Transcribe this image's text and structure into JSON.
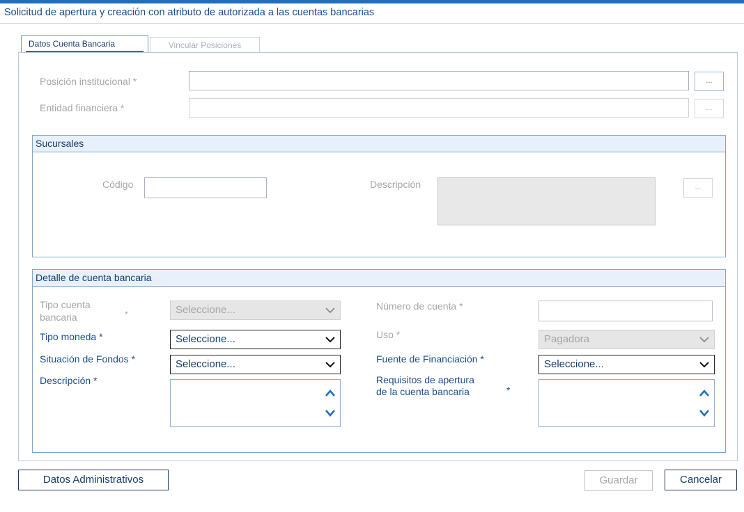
{
  "page": {
    "title": "Solicitud de apertura y creación con atributo de autorizada a las cuentas bancarias"
  },
  "tabs": [
    {
      "label": "Datos Cuenta Bancaria",
      "active": true
    },
    {
      "label": "Vincular Posiciones",
      "active": false
    }
  ],
  "form": {
    "posicion_label": "Posición institucional *",
    "posicion_value": "",
    "entidad_label": "Entidad financiera *",
    "entidad_value": "",
    "ellipsis": "..."
  },
  "sucursales": {
    "header": "Sucursales",
    "codigo_label": "Código",
    "codigo_value": "",
    "descripcion_label": "Descripción",
    "descripcion_value": ""
  },
  "detalle": {
    "header": "Detalle de cuenta bancaria",
    "tipo_cuenta_label_line1": "Tipo cuenta",
    "tipo_cuenta_label_line2": "bancaria",
    "tipo_cuenta_required": "*",
    "tipo_cuenta_value": "Seleccione...",
    "tipo_moneda_label": "Tipo moneda *",
    "tipo_moneda_value": "Seleccione...",
    "situacion_label": "Situación de Fondos *",
    "situacion_value": "Seleccione...",
    "descripcion_label": "Descripción  *",
    "numero_cuenta_label": "Número de cuenta  *",
    "numero_cuenta_value": "",
    "uso_label": "Uso *",
    "uso_value": "Pagadora",
    "fuente_label": "Fuente de Financiación *",
    "fuente_value": "Seleccione...",
    "requisitos_label_line1": "Requisitos de apertura",
    "requisitos_label_line2": "de la cuenta bancaria",
    "requisitos_required": "*"
  },
  "buttons": {
    "datos_administrativos": "Datos Administrativos",
    "guardar": "Guardar",
    "cancelar": "Cancelar"
  },
  "colors": {
    "accent": "#1f6fbf",
    "label_blue": "#1a4e8c",
    "disabled_gray": "#a6a6a6"
  }
}
